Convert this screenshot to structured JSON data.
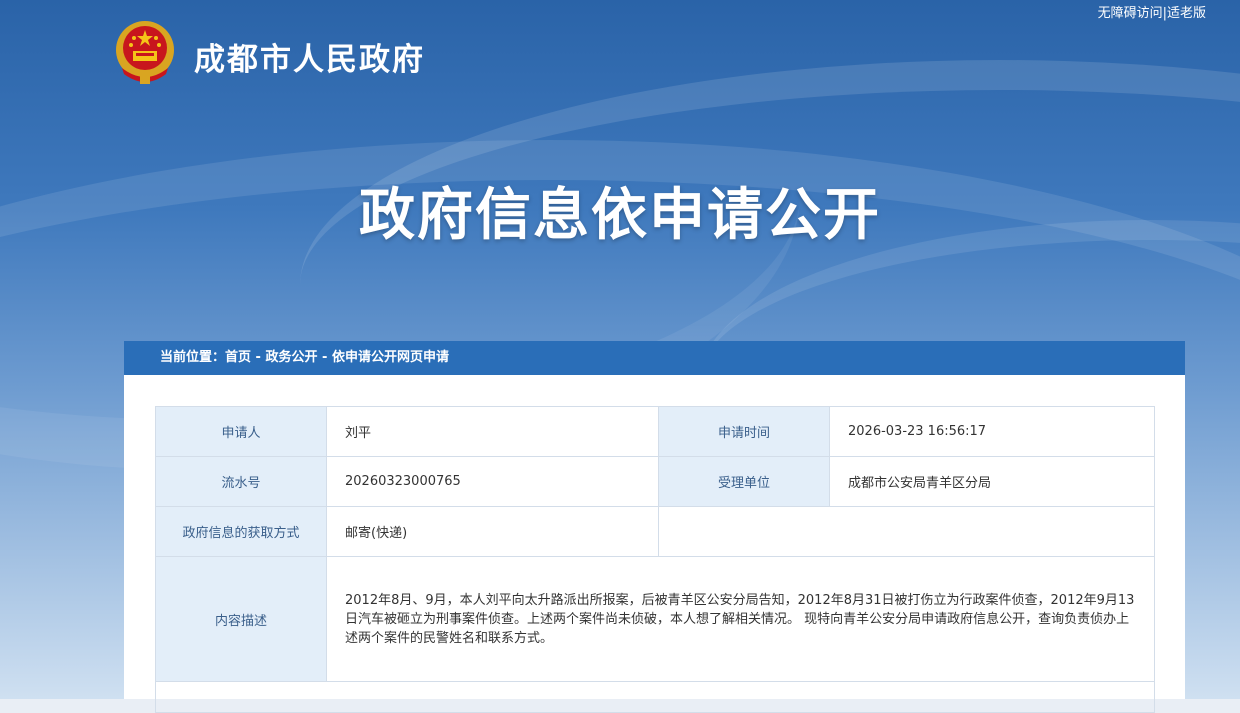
{
  "top_links": {
    "accessible": "无障碍访问",
    "separator": "|",
    "elderly": "适老版"
  },
  "site": {
    "title": "成都市人民政府"
  },
  "heading": "政府信息依申请公开",
  "breadcrumb": {
    "prefix": "当前位置：",
    "items": [
      "首页",
      "政务公开",
      "依申请公开网页申请"
    ],
    "separator": " - "
  },
  "application": {
    "applicant_label": "申请人",
    "applicant": "刘平",
    "time_label": "申请时间",
    "time": "2026-03-23 16:56:17",
    "serial_label": "流水号",
    "serial": "20260323000765",
    "unit_label": "受理单位",
    "unit": "成都市公安局青羊区分局",
    "method_label": "政府信息的获取方式",
    "method": "邮寄(快递)",
    "description_label": "内容描述",
    "description": "2012年8月、9月，本人刘平向太升路派出所报案，后被青羊区公安分局告知，2012年8月31日被打伤立为行政案件侦查，2012年9月13日汽车被砸立为刑事案件侦查。上述两个案件尚未侦破，本人想了解相关情况。 现特向青羊公安分局申请政府信息公开，查询负责侦办上述两个案件的民警姓名和联系方式。"
  },
  "colors": {
    "banner": "#3f79bd",
    "bar": "#2a6eb8",
    "label_bg": "#e3eef9"
  },
  "icons": {
    "emblem": "national-emblem-icon"
  }
}
